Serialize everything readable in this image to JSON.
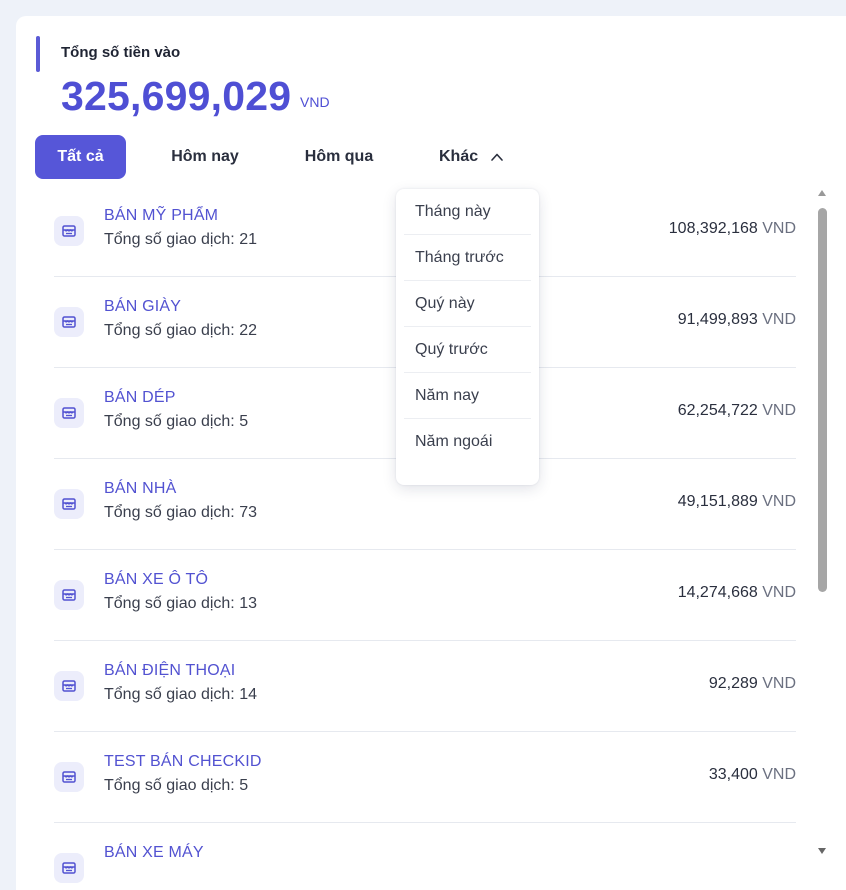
{
  "summary": {
    "label": "Tổng số tiền vào",
    "amount": "325,699,029",
    "currency": "VND"
  },
  "tabs": [
    {
      "label": "Tất cả",
      "active": true
    },
    {
      "label": "Hôm nay",
      "active": false
    },
    {
      "label": "Hôm qua",
      "active": false
    },
    {
      "label": "Khác",
      "active": false,
      "icon": "chevron-up-icon"
    }
  ],
  "dropdown": {
    "open": true,
    "items": [
      "Tháng này",
      "Tháng trước",
      "Quý này",
      "Quý trước",
      "Năm nay",
      "Năm ngoái"
    ]
  },
  "rows": [
    {
      "name": "BÁN MỸ PHẨM",
      "count": "Tổng số giao dịch: 21",
      "amount": "108,392,168",
      "currency": "VND",
      "icon": "store-icon"
    },
    {
      "name": "BÁN GIÀY",
      "count": "Tổng số giao dịch: 22",
      "amount": "91,499,893",
      "currency": "VND",
      "icon": "store-icon"
    },
    {
      "name": "BÁN DÉP",
      "count": "Tổng số giao dịch: 5",
      "amount": "62,254,722",
      "currency": "VND",
      "icon": "store-icon"
    },
    {
      "name": "BÁN NHÀ",
      "count": "Tổng số giao dịch: 73",
      "amount": "49,151,889",
      "currency": "VND",
      "icon": "store-icon"
    },
    {
      "name": "BÁN XE Ô TÔ",
      "count": "Tổng số giao dịch: 13",
      "amount": "14,274,668",
      "currency": "VND",
      "icon": "store-icon"
    },
    {
      "name": "BÁN ĐIỆN THOẠI",
      "count": "Tổng số giao dịch: 14",
      "amount": "92,289",
      "currency": "VND",
      "icon": "store-icon"
    },
    {
      "name": "TEST BÁN CHECKID",
      "count": "Tổng số giao dịch: 5",
      "amount": "33,400",
      "currency": "VND",
      "icon": "store-icon"
    },
    {
      "name": "BÁN XE MÁY",
      "count": "",
      "amount": "",
      "currency": "",
      "icon": "store-icon"
    }
  ],
  "colors": {
    "accent": "#5656d8",
    "link": "#5252d1",
    "background": "#eef2f9"
  }
}
